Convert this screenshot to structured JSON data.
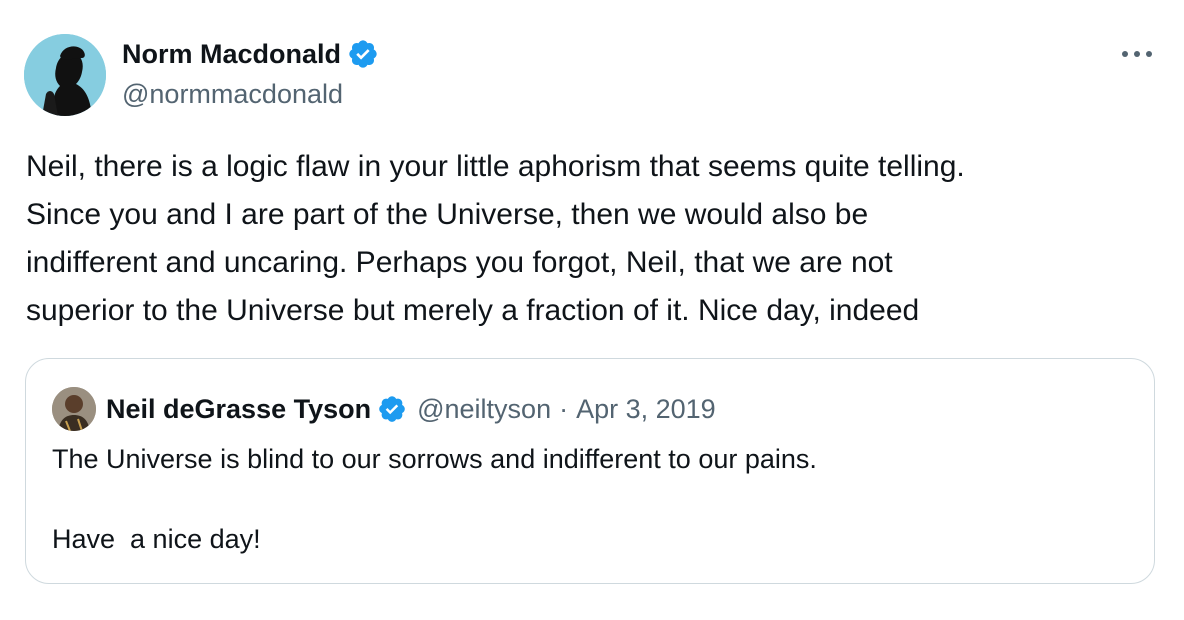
{
  "tweet": {
    "author": {
      "name": "Norm Macdonald",
      "handle": "@normmacdonald",
      "verified_icon": "verified-badge-icon"
    },
    "more_icon": "more-options-icon",
    "text": "Neil, there is a logic flaw in your little aphorism that seems quite telling.\nSince you and I are part of the Universe, then we would also be\nindifferent and uncaring. Perhaps you forgot, Neil, that we are not\nsuperior to the Universe but merely a fraction of it. Nice day, indeed"
  },
  "quoted_tweet": {
    "author": {
      "name": "Neil deGrasse Tyson",
      "handle": "@neiltyson",
      "verified_icon": "verified-badge-icon"
    },
    "separator": "·",
    "date": "Apr 3, 2019",
    "text": "The Universe is blind to our sorrows and indifferent to our pains.\n\nHave  a nice day!"
  },
  "colors": {
    "verified_blue": "#1d9bf0",
    "secondary_text": "#536471",
    "primary_text": "#0f1419",
    "border": "#cfd9de"
  }
}
